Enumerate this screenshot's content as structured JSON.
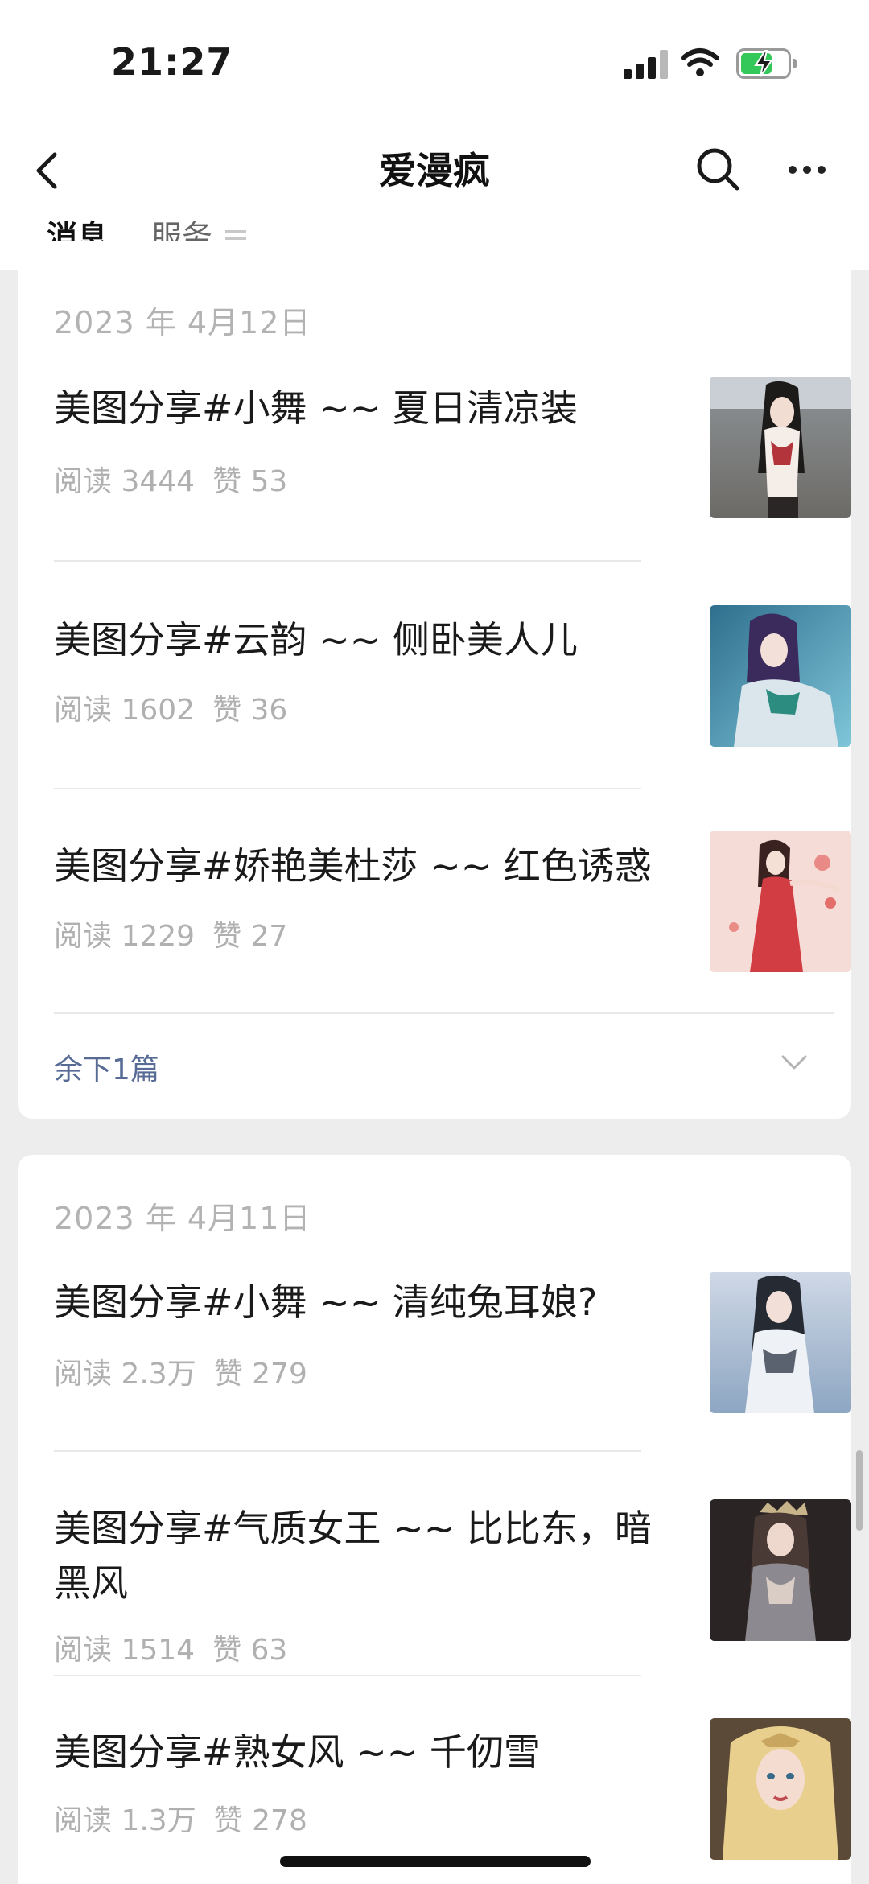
{
  "status_bar": {
    "time": "21:27",
    "battery_color": "#34c759"
  },
  "header": {
    "title": "爱漫疯",
    "back_icon": "chevron-left-icon",
    "search_icon": "search-icon",
    "more_icon": "more-icon"
  },
  "tabs": [
    {
      "label": "消息",
      "active": true
    },
    {
      "label": "服务",
      "active": false
    }
  ],
  "groups": [
    {
      "date": "2023 年 4月12日",
      "articles": [
        {
          "title": "美图分享#小舞 ~~ 夏日清凉装",
          "reads": "阅读 3444",
          "likes": "赞 53"
        },
        {
          "title": "美图分享#云韵 ~~ 侧卧美人儿",
          "reads": "阅读 1602",
          "likes": "赞 36"
        },
        {
          "title": "美图分享#娇艳美杜莎 ~~ 红色诱惑",
          "reads": "阅读 1229",
          "likes": "赞 27"
        }
      ],
      "remaining": "余下1篇"
    },
    {
      "date": "2023 年 4月11日",
      "articles": [
        {
          "title": "美图分享#小舞 ~~ 清纯兔耳娘?",
          "reads": "阅读 2.3万",
          "likes": "赞 279"
        },
        {
          "title": "美图分享#气质女王 ~~ 比比东，暗黑风",
          "reads": "阅读 1514",
          "likes": "赞 63"
        },
        {
          "title": "美图分享#熟女风 ~~ 千仞雪",
          "reads": "阅读 1.3万",
          "likes": "赞 278"
        }
      ]
    }
  ],
  "colors": {
    "link": "#576b95",
    "meta": "#b0b0b0",
    "background": "#ededed"
  }
}
